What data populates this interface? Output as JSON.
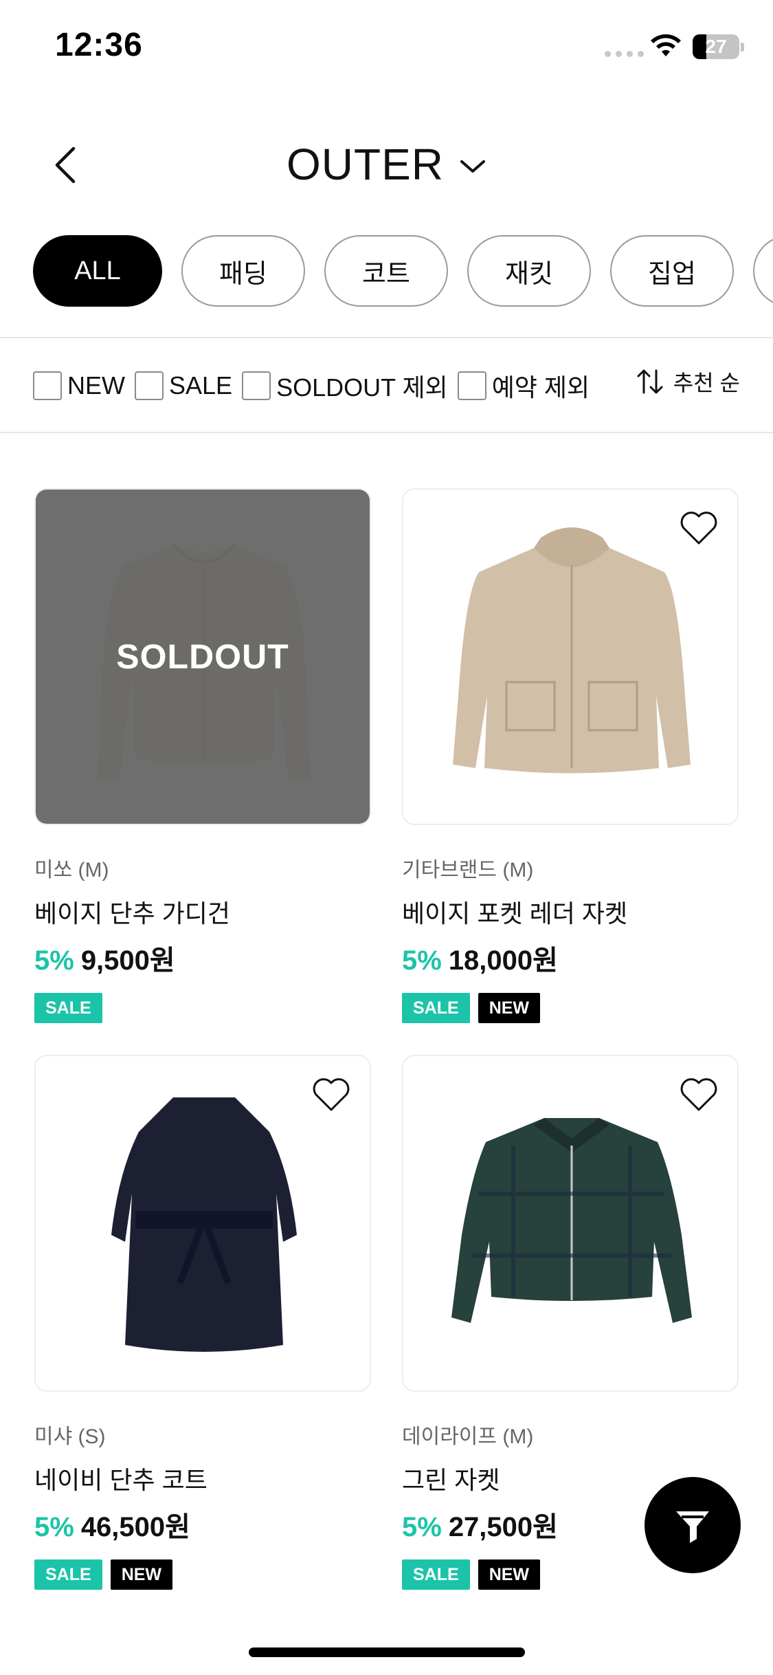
{
  "status_bar": {
    "time": "12:36",
    "battery_level": "27"
  },
  "header": {
    "title": "OUTER"
  },
  "categories": [
    {
      "label": "ALL",
      "active": true
    },
    {
      "label": "패딩",
      "active": false
    },
    {
      "label": "코트",
      "active": false
    },
    {
      "label": "재킷",
      "active": false
    },
    {
      "label": "집업",
      "active": false
    }
  ],
  "filters": [
    {
      "label": "NEW",
      "checked": false
    },
    {
      "label": "SALE",
      "checked": false
    },
    {
      "label": "SOLDOUT 제외",
      "checked": false
    },
    {
      "label": "예약 제외",
      "checked": false
    }
  ],
  "sort": {
    "label": "추천 순"
  },
  "products": [
    {
      "brand": "미쏘 (M)",
      "name": "베이지 단추 가디건",
      "discount": "5%",
      "price": "9,500원",
      "soldout_label": "SOLDOUT",
      "badges": [
        "SALE"
      ]
    },
    {
      "brand": "기타브랜드 (M)",
      "name": "베이지 포켓 레더 자켓",
      "discount": "5%",
      "price": "18,000원",
      "badges": [
        "SALE",
        "NEW"
      ]
    },
    {
      "brand": "미샤 (S)",
      "name": "네이비 단추 코트",
      "discount": "5%",
      "price": "46,500원",
      "badges": [
        "SALE",
        "NEW"
      ]
    },
    {
      "brand": "데이라이프 (M)",
      "name": "그린 자켓",
      "discount": "5%",
      "price": "27,500원",
      "badges": [
        "SALE",
        "NEW"
      ]
    }
  ],
  "colors": {
    "accent": "#1bc4a9",
    "black": "#000000",
    "soldout_overlay": "#5a5a5a"
  }
}
